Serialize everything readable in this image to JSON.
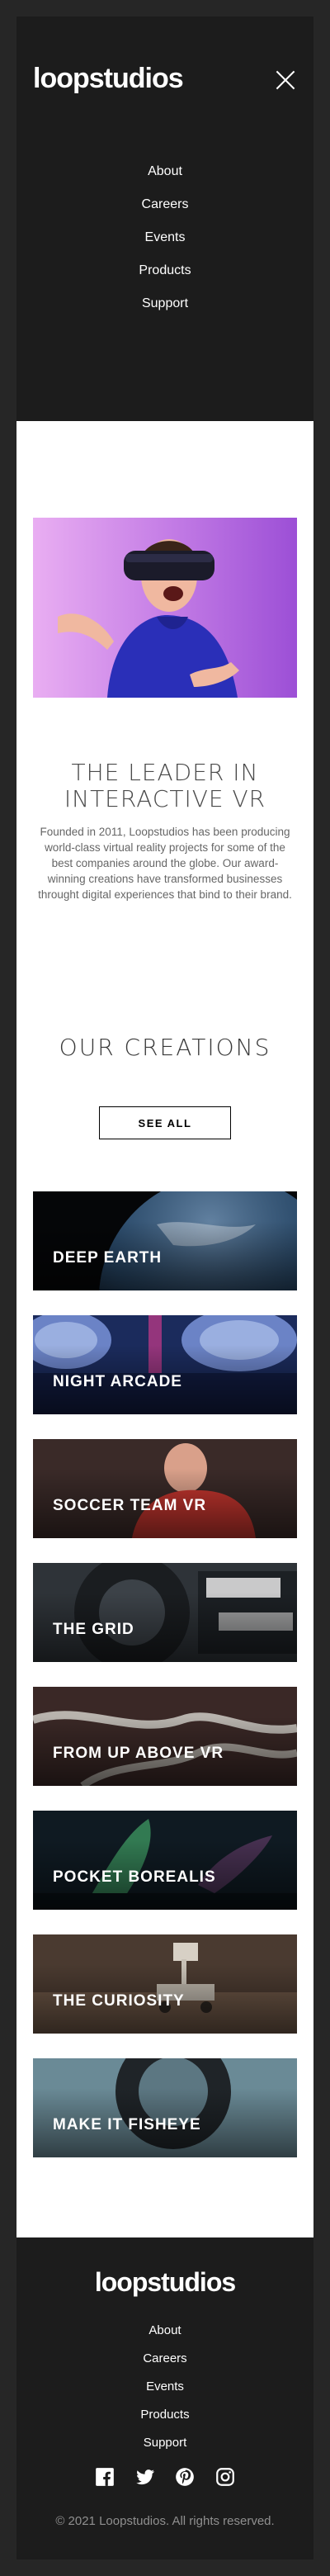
{
  "header": {
    "logo": "loopstudios",
    "nav": [
      "About",
      "Careers",
      "Events",
      "Products",
      "Support"
    ]
  },
  "hero": {
    "title": "THE LEADER IN INTERACTIVE VR",
    "text": "Founded in 2011, Loopstudios has been producing world-class virtual reality projects for some of the best companies around the globe. Our award-winning creations have transformed businesses throught digital experiences that bind to their brand."
  },
  "creations": {
    "title": "OUR CREATIONS",
    "see_all": "SEE ALL",
    "cards": [
      "DEEP EARTH",
      "NIGHT ARCADE",
      "SOCCER TEAM VR",
      "THE GRID",
      "FROM UP ABOVE VR",
      "POCKET BOREALIS",
      "THE CURIOSITY",
      "MAKE IT FISHEYE"
    ]
  },
  "footer": {
    "logo": "loopstudios",
    "nav": [
      "About",
      "Careers",
      "Events",
      "Products",
      "Support"
    ],
    "socials": [
      "facebook-icon",
      "twitter-icon",
      "pinterest-icon",
      "instagram-icon"
    ],
    "copyright": "© 2021 Loopstudios. All rights reserved."
  },
  "colors": {
    "dark": "#1c1c1c",
    "outer": "#262626",
    "white": "#ffffff",
    "muted": "#8f8f8f"
  }
}
